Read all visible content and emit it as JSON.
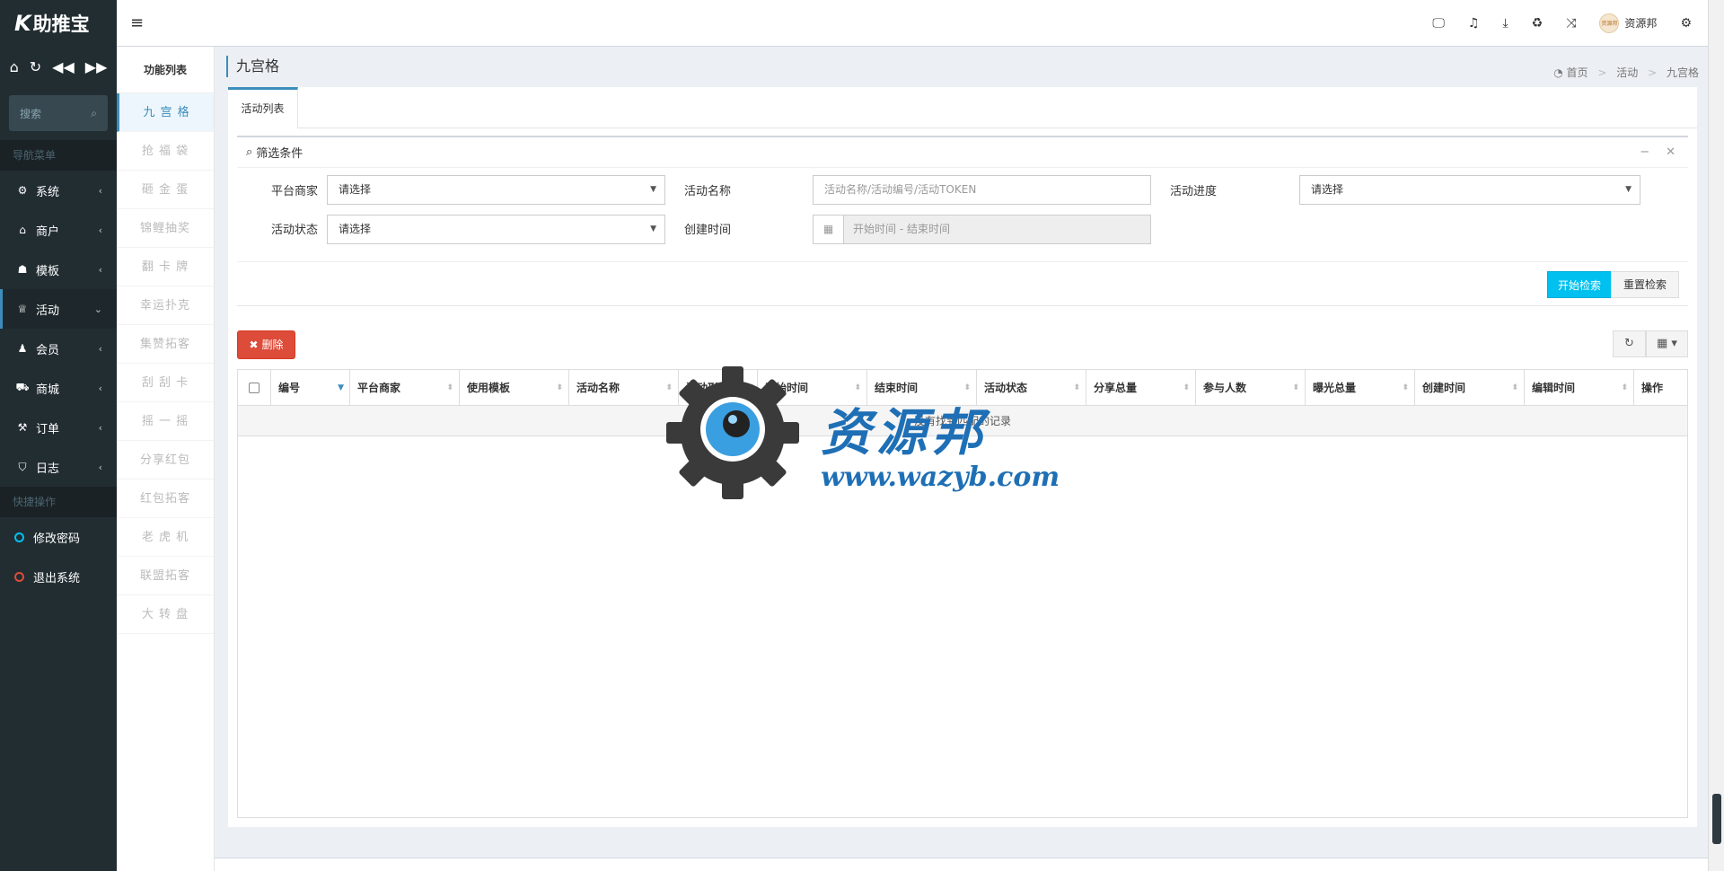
{
  "app": {
    "logo_prefix": "K",
    "logo_text": "助推宝"
  },
  "sidebar": {
    "quick_icons": [
      "home-icon",
      "refresh-icon",
      "backward-icon",
      "forward-icon"
    ],
    "search_placeholder": "搜索",
    "nav_section": "导航菜单",
    "items": [
      {
        "label": "系统",
        "icon": "gear-icon",
        "chevron": "‹"
      },
      {
        "label": "商户",
        "icon": "home-icon",
        "chevron": "‹"
      },
      {
        "label": "模板",
        "icon": "sitemap-icon",
        "chevron": "‹"
      },
      {
        "label": "活动",
        "icon": "trophy-icon",
        "chevron": "⌄"
      },
      {
        "label": "会员",
        "icon": "users-icon",
        "chevron": "‹"
      },
      {
        "label": "商城",
        "icon": "cart-icon",
        "chevron": "‹"
      },
      {
        "label": "订单",
        "icon": "gavel-icon",
        "chevron": "‹"
      },
      {
        "label": "日志",
        "icon": "shield-icon",
        "chevron": "‹"
      }
    ],
    "quick_section": "快捷操作",
    "quick_items": [
      {
        "label": "修改密码",
        "color": "#00c0ef"
      },
      {
        "label": "退出系统",
        "color": "#dd4b39"
      }
    ]
  },
  "funclist": {
    "title": "功能列表",
    "items": [
      "九 宫 格",
      "抢 福 袋",
      "砸 金 蛋",
      "锦鲤抽奖",
      "翻 卡 牌",
      "幸运扑克",
      "集赞拓客",
      "刮 刮 卡",
      "摇 一 摇",
      "分享红包",
      "红包拓客",
      "老 虎 机",
      "联盟拓客",
      "大 转 盘"
    ]
  },
  "topbar": {
    "user_name": "资源邦",
    "avatar_text": "资源邦"
  },
  "page": {
    "title": "九宫格",
    "breadcrumb": [
      "首页",
      "活动",
      "九宫格"
    ]
  },
  "tabs": [
    "活动列表"
  ],
  "filter": {
    "title": "筛选条件",
    "fields": {
      "merchant_label": "平台商家",
      "merchant_value": "请选择",
      "name_label": "活动名称",
      "name_placeholder": "活动名称/活动编号/活动TOKEN",
      "progress_label": "活动进度",
      "progress_value": "请选择",
      "status_label": "活动状态",
      "status_value": "请选择",
      "created_label": "创建时间",
      "created_placeholder": "开始时间 - 结束时间"
    },
    "search_button": "开始检索",
    "reset_button": "重置检索"
  },
  "toolbar": {
    "delete_button": "删除"
  },
  "table": {
    "columns": [
      "编号",
      "平台商家",
      "使用模板",
      "活动名称",
      "活动形式",
      "开始时间",
      "结束时间",
      "活动状态",
      "分享总量",
      "参与人数",
      "曝光总量",
      "创建时间",
      "编辑时间",
      "操作"
    ],
    "empty_text": "没有找到匹配的记录"
  },
  "watermark": {
    "cn": "资源邦",
    "url": "www.wazyb.com"
  },
  "colors": {
    "accent": "#3c8dbc",
    "sidebar_bg": "#222d32",
    "search_btn": "#00c0ef",
    "danger": "#dd4b39"
  }
}
